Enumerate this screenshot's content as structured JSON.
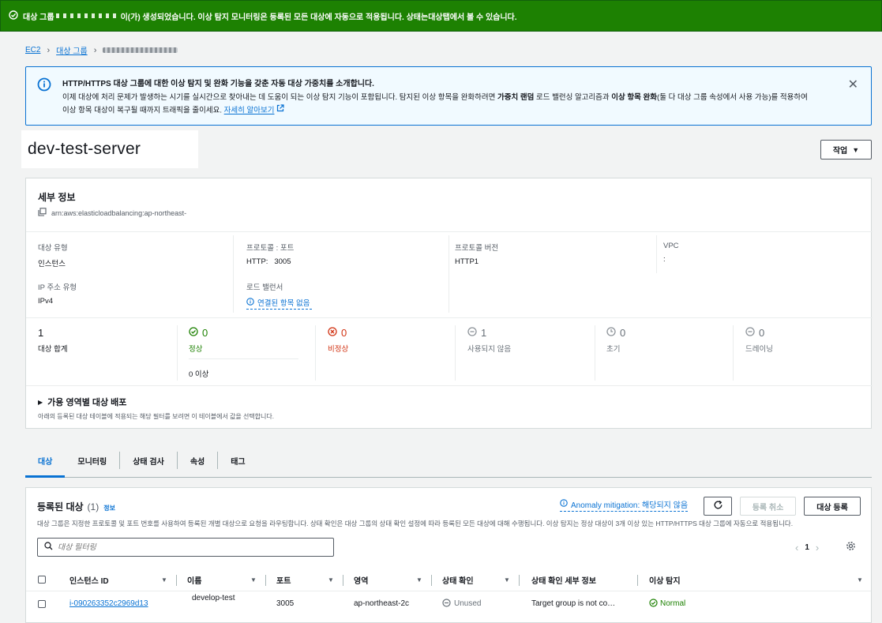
{
  "flash": {
    "message_prefix": "대상 그룹 ",
    "message_suffix": "이(가) 생성되었습니다. 이상 탐지 모니터링은 등록된 모든 대상에 자동으로 적용됩니다. 상태는 ",
    "message_bold": "대상",
    "message_end": " 탭에서 볼 수 있습니다."
  },
  "breadcrumb": {
    "root": "EC2",
    "parent": "대상 그룹"
  },
  "info_banner": {
    "title": "HTTP/HTTPS 대상 그룹에 대한 이상 탐지 및 완화 기능을 갖춘 자동 대상 가중치를 소개합니다.",
    "body_1": "이제 대상에 처리 문제가 발생하는 시기를 실시간으로 찾아내는 데 도움이 되는 이상 탐지 기능이 포함됩니다. 탐지된 이상 항목을 완화하려면 ",
    "body_bold_1": "가중치 랜덤",
    "body_2": " 로드 밸런싱 알고리즘과 ",
    "body_bold_2": "이상 항목 완화",
    "body_3": "(둘 다 대상 그룹 속성에서 사용 가능)를 적용하여",
    "body_4": "이상 항목 대상이 복구될 때까지 트래픽을 줄이세요. ",
    "learn_more": "자세히 알아보기"
  },
  "page_title": "dev-test-server",
  "actions_label": "작업",
  "details": {
    "heading": "세부 정보",
    "arn": "arn:aws:elasticloadbalancing:ap-northeast-",
    "target_type_label": "대상 유형",
    "target_type_value": "인스턴스",
    "protocol_port_label": "프로토콜 : 포트",
    "protocol_port_value": "HTTP:   3005",
    "protocol_version_label": "프로토콜 버전",
    "protocol_version_value": "HTTP1",
    "vpc_label": "VPC",
    "vpc_value": ":",
    "ip_type_label": "IP 주소 유형",
    "ip_type_value": "IPv4",
    "lb_label": "로드 밸런서",
    "lb_value": "연결된 항목 없음"
  },
  "stats": {
    "total": {
      "value": "1",
      "label": "대상 합계"
    },
    "healthy": {
      "value": "0",
      "label": "정상",
      "sub": "0 이상"
    },
    "unhealthy": {
      "value": "0",
      "label": "비정상"
    },
    "unused": {
      "value": "1",
      "label": "사용되지 않음"
    },
    "initial": {
      "value": "0",
      "label": "초기"
    },
    "draining": {
      "value": "0",
      "label": "드레이닝"
    }
  },
  "az": {
    "heading": "가용 영역별 대상 배포",
    "sub": "아래의 등록된 대상 테이블에 적용되는 해당 필터를 보려면 이 테이블에서 값을 선택합니다."
  },
  "tabs": [
    "대상",
    "모니터링",
    "상태 검사",
    "속성",
    "태그"
  ],
  "registered": {
    "heading": "등록된 대상",
    "count": "(1)",
    "info": "정보",
    "description": "대상 그룹은 지정한 프로토콜 및 포트 번호를 사용하여 등록된 개별 대상으로 요청을 라우팅합니다. 상태 확인은 대상 그룹의 상태 확인 설정에 따라 등록된 모든 대상에 대해 수행됩니다. 이상 탐지는 정상 대상이 3개 이상 있는 HTTP/HTTPS 대상 그룹에 자동으로 적용됩니다.",
    "anomaly": "Anomaly mitigation: 해당되지 않음",
    "deregister": "등록 취소",
    "register": "대상 등록",
    "filter_placeholder": "대상 필터링",
    "page": "1",
    "columns": [
      "인스턴스 ID",
      "이름",
      "포트",
      "영역",
      "상태 확인",
      "상태 확인 세부 정보",
      "이상 탐지"
    ],
    "rows": [
      {
        "instance_id": "i-090263352c2969d13",
        "name": "develop-test",
        "port": "3005",
        "zone": "ap-northeast-2c",
        "health": "Unused",
        "health_details": "Target group is not co…",
        "anomaly": "Normal"
      }
    ]
  },
  "colors": {
    "success": "#1d8102",
    "link": "#0972d3",
    "error": "#d13212"
  }
}
